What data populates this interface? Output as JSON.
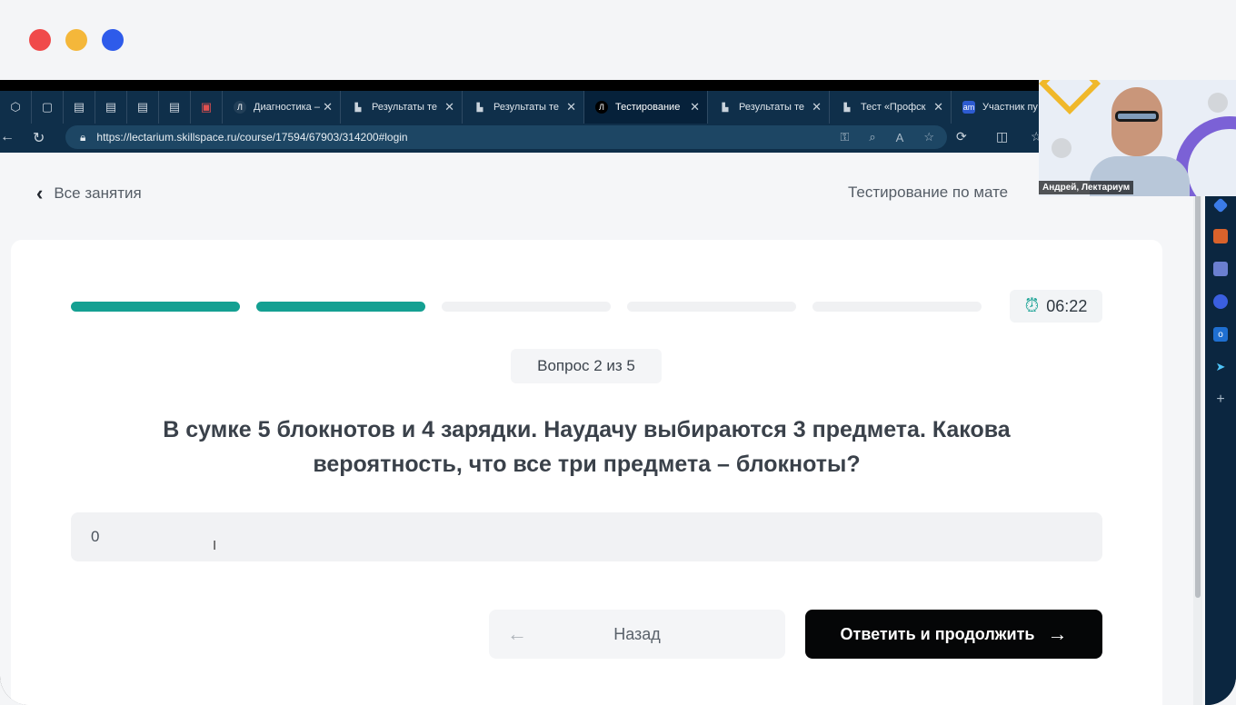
{
  "window_controls": {
    "close_color": "#f04a4a",
    "minimize_color": "#f4b73a",
    "maximize_color": "#2e5bea"
  },
  "browser": {
    "tabs": [
      {
        "label": "Диагностика –",
        "favicon": "Л"
      },
      {
        "label": "Результаты те",
        "favicon": "chart-icon"
      },
      {
        "label": "Результаты те",
        "favicon": "chart-icon"
      },
      {
        "label": "Тестирование",
        "favicon": "Л",
        "active": true
      },
      {
        "label": "Результаты те",
        "favicon": "chart-icon"
      },
      {
        "label": "Тест «Профск",
        "favicon": "chart-icon"
      },
      {
        "label": "Участник пу",
        "favicon": "am"
      }
    ],
    "url": "https://lectarium.skillspace.ru/course/17594/67903/314200#login"
  },
  "page": {
    "back_link": "Все занятия",
    "course_title": "Тестирование по мате",
    "progress": {
      "total": 5,
      "completed": 2
    },
    "timer": "06:22",
    "question_badge": "Вопрос 2 из 5",
    "question_text": "В сумке 5 блокнотов и 4 зарядки. Наудачу выбираются 3 предмета. Какова вероятность, что все три предмета – блокноты?",
    "answer_value": "0",
    "back_button": "Назад",
    "next_button": "Ответить и продолжить",
    "accent_color": "#14a092"
  },
  "video_overlay": {
    "name": "Андрей, Лектариум"
  }
}
